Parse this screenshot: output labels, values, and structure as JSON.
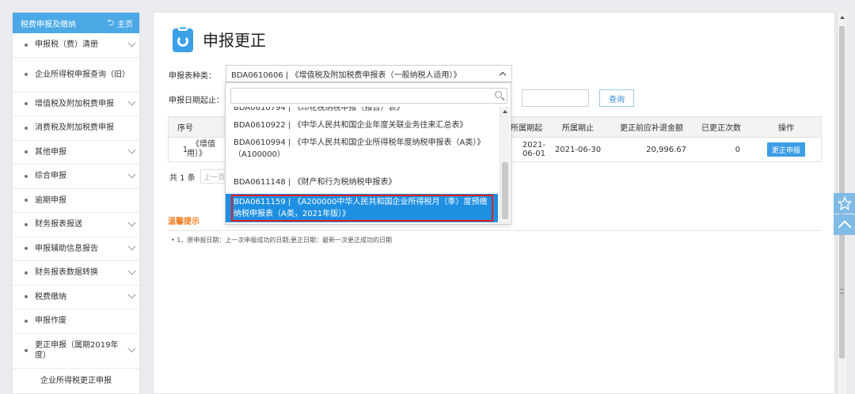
{
  "sidebar": {
    "header_title": "税费申报及缴纳",
    "home_label": "主页",
    "items": [
      {
        "label": "申报税（费）清册"
      },
      {
        "label": "企业所得税申报查询（旧）"
      },
      {
        "label": "增值税及附加税费申报"
      },
      {
        "label": "消费税及附加税费申报"
      },
      {
        "label": "其他申报"
      },
      {
        "label": "综合申报"
      },
      {
        "label": "逾期申报"
      },
      {
        "label": "财务报表报送"
      },
      {
        "label": "申报辅助信息报告"
      },
      {
        "label": "财务报表数据转换"
      },
      {
        "label": "税费缴纳"
      },
      {
        "label": "申报作废"
      },
      {
        "label": "更正申报（属期2019年度）"
      }
    ],
    "sub_item": "企业所得税更正申报"
  },
  "main": {
    "page_title": "申报更正",
    "type_label": "申报表种类：",
    "type_selected": "BDA0610606 | 《增值税及附加税费申报表（一般纳税人适用）》",
    "date_label": "申报日期起止：",
    "query_button": "查询",
    "table": {
      "headers": [
        "序号",
        "所属期起",
        "所属期止",
        "更正前应补退金额",
        "已更正次数",
        "操作"
      ],
      "rows": [
        {
          "index": "1",
          "name_fragment_1": "《增值",
          "name_fragment_2": "用）》",
          "period_start": "2021-06-01",
          "period_end": "2021-06-30",
          "amount": "20,996.67",
          "count": "0",
          "action": "更正申报"
        }
      ]
    },
    "pager": {
      "total": "共 1 条",
      "prev": "上一页"
    },
    "tips_title": "温馨提示",
    "tips_item": "1、原申报日期：上一次申报成功的日期;更正日期：最新一次更正成功的日期"
  },
  "dropdown": {
    "search_placeholder": "",
    "options": [
      {
        "label": "BDA0610794 | 《印花税纳税申报（报告）表》"
      },
      {
        "label": "BDA0610922 | 《中华人民共和国企业年度关联业务往来汇总表》"
      },
      {
        "label": "BDA0610994 | 《中华人民共和国企业所得税年度纳税申报表（A类）》（A100000）"
      },
      {
        "label": "BDA0611148 | 《财产和行为税纳税申报表》"
      },
      {
        "label": "BDA0611159 | 《A200000中华人民共和国企业所得税月（季）度预缴纳税申报表（A类，2021年版）》"
      }
    ],
    "selected_index": 4
  },
  "colors": {
    "accent": "#3d9de6",
    "sidebar_header": "#4ba9e6",
    "highlight": "#e02020",
    "tips": "#f07c1c"
  }
}
